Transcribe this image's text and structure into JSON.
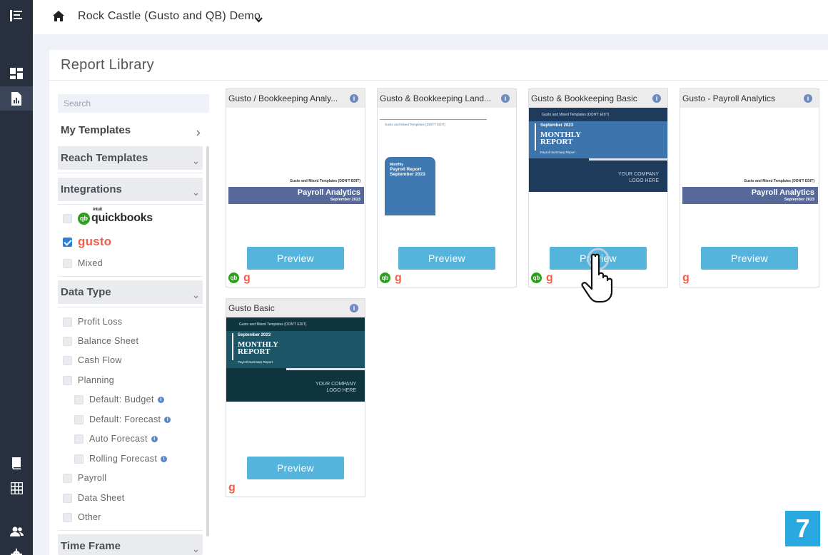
{
  "topbar": {
    "company": "Rock Castle (Gusto and QB) Demo"
  },
  "panel": {
    "title": "Report Library"
  },
  "sidebar": {
    "search_placeholder": "Search",
    "my_templates": "My Templates",
    "reach_templates": "Reach Templates",
    "integrations": {
      "label": "Integrations",
      "items": [
        {
          "label": "quickbooks",
          "sub": "intuit",
          "checked": false
        },
        {
          "label": "gusto",
          "checked": true
        },
        {
          "label": "Mixed",
          "checked": false
        }
      ]
    },
    "data_type": {
      "label": "Data Type",
      "items": [
        {
          "label": "Profit Loss"
        },
        {
          "label": "Balance Sheet"
        },
        {
          "label": "Cash Flow"
        },
        {
          "label": "Planning"
        },
        {
          "label": "Default: Budget"
        },
        {
          "label": "Default: Forecast"
        },
        {
          "label": "Auto Forecast"
        },
        {
          "label": "Rolling Forecast"
        },
        {
          "label": "Payroll"
        },
        {
          "label": "Data Sheet"
        },
        {
          "label": "Other"
        }
      ]
    },
    "time_frame": "Time Frame"
  },
  "cards": [
    {
      "title": "Gusto / Bookkeeping Analy...",
      "preview": "Preview",
      "thumb_header": "Gusto and Mixed Templates (DON'T EDIT)",
      "thumb_title": "Payroll Analytics",
      "thumb_date": "September 2023"
    },
    {
      "title": "Gusto & Bookkeeping Land...",
      "preview": "Preview",
      "thumb_header": "Gusto and Mixed Templates (DON'T EDIT)",
      "thumb_title_1": "Monthly",
      "thumb_title_2": "Payroll Report",
      "thumb_date": "September 2023"
    },
    {
      "title": "Gusto & Bookkeeping Basic",
      "preview": "Preview",
      "thumb_header": "Gusto and Mixed Templates (DON'T EDIT)",
      "thumb_date": "September 2023",
      "thumb_title": "MONTHLY REPORT",
      "thumb_sub": "Payroll Summary Report",
      "thumb_logo_1": "YOUR COMPANY",
      "thumb_logo_2": "LOGO HERE"
    },
    {
      "title": "Gusto - Payroll Analytics",
      "preview": "Preview",
      "thumb_header": "Gusto and Mixed Templates (DON'T EDIT)",
      "thumb_title": "Payroll Analytics",
      "thumb_date": "September 2023"
    },
    {
      "title": "Gusto Basic",
      "preview": "Preview",
      "thumb_header": "Gusto and Mixed Templates (DON'T EDIT)",
      "thumb_date": "September 2023",
      "thumb_title": "MONTHLY REPORT",
      "thumb_sub": "Payroll Summary Report",
      "thumb_logo_1": "YOUR COMPANY",
      "thumb_logo_2": "LOGO HERE"
    }
  ],
  "step_number": "7",
  "colors": {
    "rail": "#283040",
    "preview_button": "#55b4dc",
    "gusto": "#f45d48",
    "quickbooks": "#2ca01c",
    "step_badge": "#2aa9e0"
  }
}
